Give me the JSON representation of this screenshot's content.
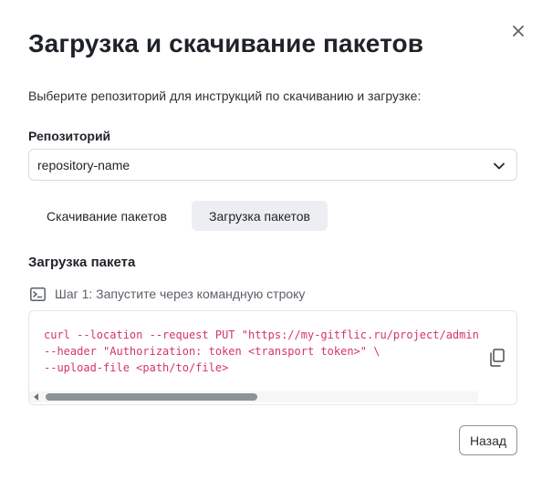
{
  "dialog": {
    "title": "Загрузка и скачивание пакетов",
    "subtitle": "Выберите репозиторий для инструкций по скачиванию и загрузке:",
    "close_icon": "close-icon"
  },
  "repository": {
    "label": "Репозиторий",
    "selected": "repository-name",
    "chevron_icon": "chevron-down-icon"
  },
  "tabs": [
    {
      "label": "Скачивание пакетов",
      "active": false
    },
    {
      "label": "Загрузка пакетов",
      "active": true
    }
  ],
  "section": {
    "title": "Загрузка пакета",
    "step_icon": "terminal-icon",
    "step_label": "Шаг 1: Запустите через командную строку"
  },
  "code": {
    "lines": [
      "curl --location --request PUT \"https://my-gitflic.ru/project/adminus",
      "--header \"Authorization: token <transport token>\" \\",
      "--upload-file <path/to/file>"
    ],
    "copy_icon": "copy-icon"
  },
  "footer": {
    "back_label": "Назад"
  },
  "colors": {
    "code_text": "#d6336c",
    "active_tab_bg": "#eceef1",
    "border": "#d7dbe0"
  }
}
